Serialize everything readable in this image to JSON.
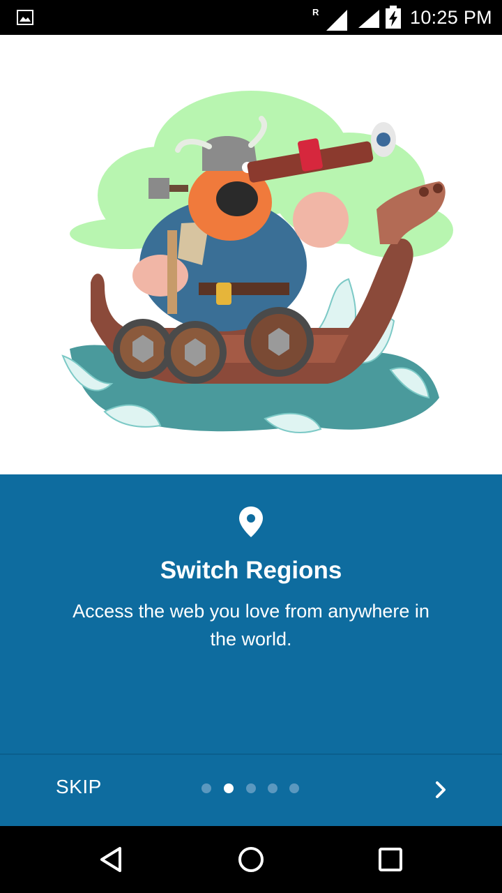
{
  "status_bar": {
    "time": "10:25 PM",
    "roaming_indicator": "R",
    "icons": [
      "image-notification-icon",
      "signal-roaming-icon",
      "signal-icon",
      "battery-charging-icon"
    ]
  },
  "illustration": {
    "subject": "viking-on-longship-illustration"
  },
  "onboarding": {
    "icon": "location-pin-icon",
    "title": "Switch Regions",
    "description": "Access the web you love from anywhere in the world.",
    "skip_label": "SKIP",
    "page_count": 5,
    "current_page": 2,
    "next_icon": "chevron-right-icon"
  },
  "colors": {
    "panel": "#0e6c9f",
    "dot_inactive": "#5b98bf",
    "dot_active": "#ffffff"
  },
  "nav_bar": {
    "icons": [
      "back-icon",
      "home-icon",
      "recents-icon"
    ]
  }
}
